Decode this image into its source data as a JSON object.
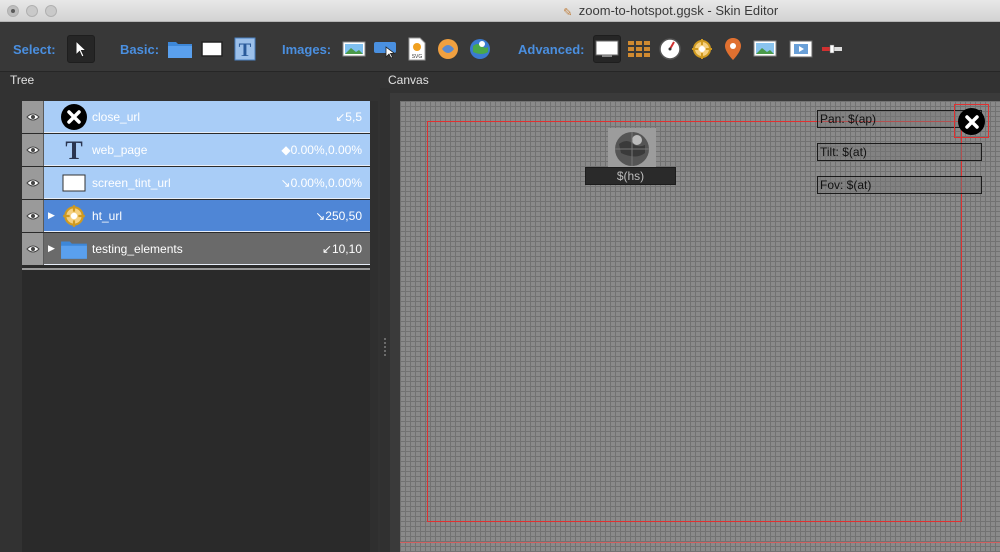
{
  "window": {
    "title": "zoom-to-hotspot.ggsk - Skin Editor"
  },
  "toolbar": {
    "select_label": "Select:",
    "basic_label": "Basic:",
    "images_label": "Images:",
    "advanced_label": "Advanced:"
  },
  "sections": {
    "tree": "Tree",
    "canvas": "Canvas"
  },
  "tree": {
    "rows": [
      {
        "name": "close_url",
        "pos": "↙5,5",
        "style": "light",
        "icon": "close-circle-icon"
      },
      {
        "name": "web_page",
        "pos": "◆0.00%,0.00%",
        "style": "light",
        "icon": "text-icon"
      },
      {
        "name": "screen_tint_url",
        "pos": "↘0.00%,0.00%",
        "style": "light",
        "icon": "rectangle-icon"
      },
      {
        "name": "ht_url",
        "pos": "↘250,50",
        "style": "selected",
        "icon": "hotspot-icon"
      },
      {
        "name": "testing_elements",
        "pos": "↙10,10",
        "style": "gray",
        "icon": "folder-icon"
      }
    ]
  },
  "canvas": {
    "hotspot_label": "$(hs)",
    "pan_label": "Pan: $(ap)",
    "tilt_label": "Tilt: $(at)",
    "fov_label": "Fov: $(at)"
  },
  "colors": {
    "accent": "#4a8fe0",
    "selection": "#4f86d6",
    "row_light": "#a9cdf7",
    "red_frame": "#e03030"
  }
}
